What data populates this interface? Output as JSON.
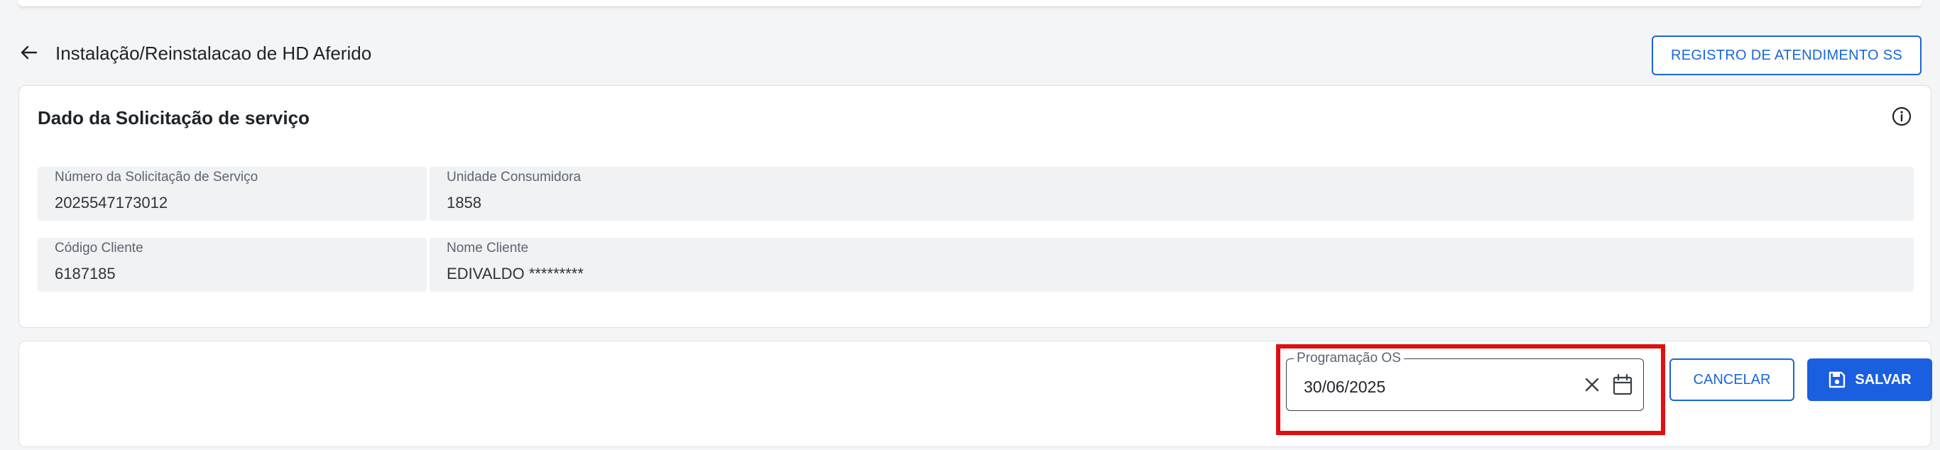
{
  "header": {
    "title": "Instalação/Reinstalacao de HD Aferido",
    "registro_button": "REGISTRO DE ATENDIMENTO SS"
  },
  "solicitacao": {
    "title": "Dado da Solicitação de serviço",
    "fields": [
      {
        "label": "Número da Solicitação de Serviço",
        "value": "2025547173012"
      },
      {
        "label": "Unidade Consumidora",
        "value": "1858"
      },
      {
        "label": "Código Cliente",
        "value": "6187185"
      },
      {
        "label": "Nome Cliente",
        "value": "EDIVALDO *********"
      }
    ]
  },
  "actions": {
    "programacao_label": "Programação OS",
    "programacao_value": "30/06/2025",
    "cancel_label": "CANCELAR",
    "save_label": "SALVAR"
  },
  "icons": {
    "back": "arrow-left-icon",
    "info": "info-icon",
    "clear": "close-icon",
    "calendar": "calendar-icon",
    "save": "floppy-disk-icon"
  },
  "colors": {
    "primary": "#1a66d8",
    "save_bg": "#1a5fe0",
    "highlight": "#e01010",
    "field_bg": "#f0f2f4"
  }
}
